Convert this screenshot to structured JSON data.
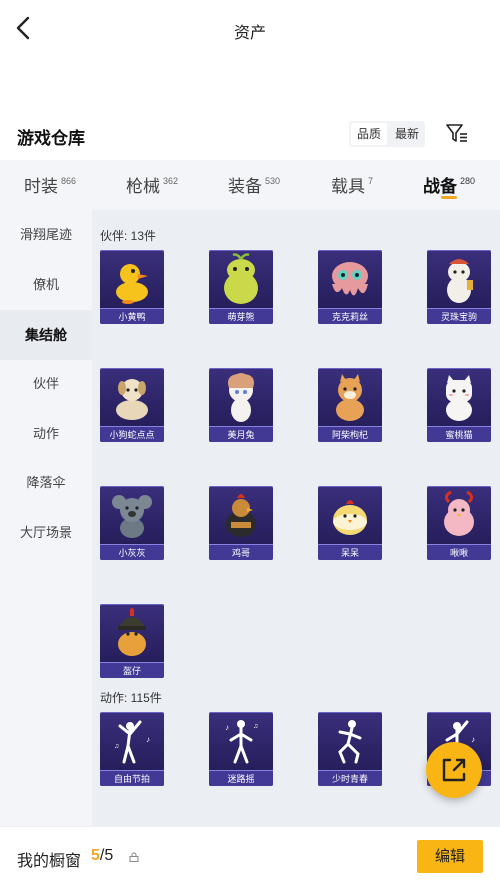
{
  "header": {
    "title": "资产"
  },
  "warehouse": {
    "title": "游戏仓库",
    "sort_options": [
      "品质",
      "最新"
    ]
  },
  "tabs": [
    {
      "label": "时装",
      "count": "866"
    },
    {
      "label": "枪械",
      "count": "362"
    },
    {
      "label": "装备",
      "count": "530"
    },
    {
      "label": "载具",
      "count": "7"
    },
    {
      "label": "战备",
      "count": "280",
      "active": true
    }
  ],
  "sidebar": {
    "items": [
      {
        "label": "滑翔尾迹"
      },
      {
        "label": "僚机"
      },
      {
        "label": "集结舱",
        "active": true
      },
      {
        "label": "伙伴"
      },
      {
        "label": "动作"
      },
      {
        "label": "降落伞"
      },
      {
        "label": "大厅场景"
      }
    ]
  },
  "sections": [
    {
      "label": "伙伴: 13件",
      "items": [
        {
          "name": "小黄鸭",
          "icon": "yellow-duck-icon"
        },
        {
          "name": "萌芽熊",
          "icon": "sprout-bear-icon"
        },
        {
          "name": "克克莉丝",
          "icon": "octopus-icon"
        },
        {
          "name": "灵珠宝驹",
          "icon": "pony-icon"
        },
        {
          "name": "小狗蛇点点",
          "icon": "dog-icon"
        },
        {
          "name": "美月兔",
          "icon": "rabbit-icon"
        },
        {
          "name": "阿柴枸杞",
          "icon": "shiba-icon"
        },
        {
          "name": "蜜桃猫",
          "icon": "cat-icon"
        },
        {
          "name": "小灰灰",
          "icon": "grey-koala-icon"
        },
        {
          "name": "鸡哥",
          "icon": "rooster-icon"
        },
        {
          "name": "呆呆",
          "icon": "chick-icon"
        },
        {
          "name": "啾啾",
          "icon": "pink-bird-icon"
        },
        {
          "name": "盔仔",
          "icon": "helmet-chick-icon"
        }
      ]
    },
    {
      "label": "动作: 115件",
      "items": [
        {
          "name": "自由节拍",
          "icon": "dance-pose-icon"
        },
        {
          "name": "迷路摇",
          "icon": "dance-pose-icon"
        },
        {
          "name": "少时青春",
          "icon": "dance-pose-icon"
        },
        {
          "name": "",
          "icon": "dance-pose-icon"
        }
      ]
    }
  ],
  "bottom": {
    "showcase_label": "我的橱窗",
    "current": "5",
    "total": "/5",
    "edit_label": "编辑"
  },
  "colors": {
    "accent": "#f8b514",
    "card_bg": "#2a2263"
  }
}
